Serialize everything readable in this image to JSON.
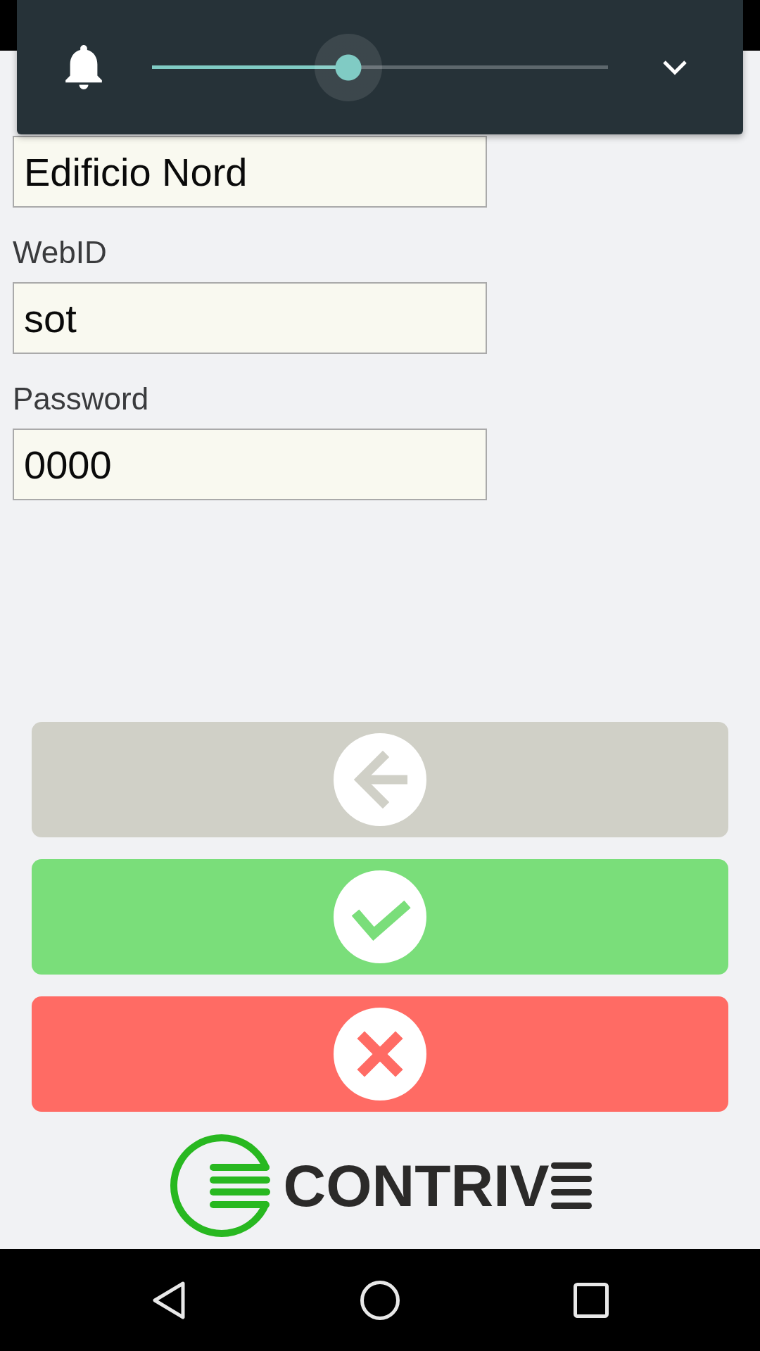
{
  "volume_panel": {
    "level": 0.43,
    "expanded": false
  },
  "form": {
    "fields": [
      {
        "value": "Edificio Nord"
      },
      {
        "label": "WebID",
        "value": "sot"
      },
      {
        "label": "Password",
        "value": "0000"
      }
    ]
  },
  "actions": [
    {
      "kind": "back"
    },
    {
      "kind": "confirm"
    },
    {
      "kind": "cancel"
    }
  ],
  "logo": {
    "text": "CONTRIV"
  },
  "nav_bar": {
    "buttons": [
      {
        "kind": "back"
      },
      {
        "kind": "home"
      },
      {
        "kind": "recents"
      }
    ]
  }
}
